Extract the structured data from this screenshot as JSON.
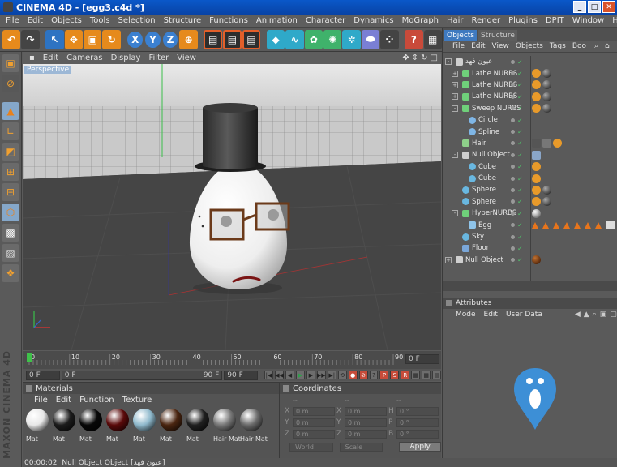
{
  "window": {
    "title": "CINEMA 4D - [egg3.c4d *]"
  },
  "menus": [
    "File",
    "Edit",
    "Objects",
    "Tools",
    "Selection",
    "Structure",
    "Functions",
    "Animation",
    "Character",
    "Dynamics",
    "MoGraph",
    "Hair",
    "Render",
    "Plugins",
    "DPIT",
    "Window",
    "Help"
  ],
  "viewport": {
    "menu": [
      "Edit",
      "Cameras",
      "Display",
      "Filter",
      "View"
    ],
    "label": "Perspective"
  },
  "timeline": {
    "ticks": [
      "0",
      "10",
      "20",
      "30",
      "40",
      "50",
      "60",
      "70",
      "80",
      "90"
    ],
    "current": "0 F",
    "start": "0 F",
    "preview_start": "0 F",
    "preview_end": "90 F",
    "end": "90 F"
  },
  "materials": {
    "title": "Materials",
    "menu": [
      "File",
      "Edit",
      "Function",
      "Texture"
    ],
    "items": [
      {
        "name": "Mat",
        "color": "#e8e8e8"
      },
      {
        "name": "Mat",
        "color": "#1c1c1c"
      },
      {
        "name": "Mat",
        "color": "#080808"
      },
      {
        "name": "Mat",
        "color": "#5a0a0a"
      },
      {
        "name": "Mat",
        "color": "#8fb9cc"
      },
      {
        "name": "Mat",
        "color": "#4a2510"
      },
      {
        "name": "Mat",
        "color": "#202020"
      },
      {
        "name": "Hair Mat",
        "color": "#777777"
      },
      {
        "name": "Hair Mat",
        "color": "#6a6a6a"
      }
    ]
  },
  "coordinates": {
    "title": "Coordinates",
    "header": [
      "--",
      "--",
      "--"
    ],
    "rows": [
      {
        "a": "X",
        "av": "0 m",
        "b": "X",
        "bv": "0 m",
        "c": "H",
        "cv": "0 °"
      },
      {
        "a": "Y",
        "av": "0 m",
        "b": "Y",
        "bv": "0 m",
        "c": "P",
        "cv": "0 °"
      },
      {
        "a": "Z",
        "av": "0 m",
        "b": "Z",
        "bv": "0 m",
        "c": "B",
        "cv": "0 °"
      }
    ],
    "mode_left": "World",
    "mode_right": "Scale",
    "apply": "Apply"
  },
  "status": {
    "time": "00:00:02",
    "message": "Null Object Object [عيون فهد]"
  },
  "objects": {
    "tabs": [
      "Objects",
      "Structure"
    ],
    "menu": [
      "File",
      "Edit",
      "View",
      "Objects",
      "Tags",
      "Boo"
    ],
    "items": [
      {
        "name": "عيون فهد",
        "indent": 0,
        "icon": "null",
        "tree": "-"
      },
      {
        "name": "Lathe NURBS",
        "indent": 1,
        "icon": "nurbs",
        "tree": "+"
      },
      {
        "name": "Lathe NURBS",
        "indent": 1,
        "icon": "nurbs",
        "tree": "+"
      },
      {
        "name": "Lathe NURBS",
        "indent": 1,
        "icon": "nurbs",
        "tree": "+"
      },
      {
        "name": "Sweep NURBS",
        "indent": 1,
        "icon": "nurbs",
        "tree": "-"
      },
      {
        "name": "Circle",
        "indent": 2,
        "icon": "spline",
        "tree": ""
      },
      {
        "name": "Spline",
        "indent": 2,
        "icon": "spline",
        "tree": ""
      },
      {
        "name": "Hair",
        "indent": 1,
        "icon": "hair",
        "tree": ""
      },
      {
        "name": "Null Object",
        "indent": 1,
        "icon": "null",
        "tree": "-"
      },
      {
        "name": "Cube",
        "indent": 2,
        "icon": "prim",
        "tree": ""
      },
      {
        "name": "Cube",
        "indent": 2,
        "icon": "prim",
        "tree": ""
      },
      {
        "name": "Sphere",
        "indent": 1,
        "icon": "prim",
        "tree": ""
      },
      {
        "name": "Sphere",
        "indent": 1,
        "icon": "prim",
        "tree": ""
      },
      {
        "name": "HyperNURBS",
        "indent": 1,
        "icon": "nurbs",
        "tree": "-"
      },
      {
        "name": "Egg",
        "indent": 2,
        "icon": "poly",
        "tree": ""
      },
      {
        "name": "Sky",
        "indent": 1,
        "icon": "prim",
        "tree": ""
      },
      {
        "name": "Floor",
        "indent": 1,
        "icon": "floor",
        "tree": ""
      },
      {
        "name": "Null Object",
        "indent": 0,
        "icon": "null",
        "tree": "+"
      }
    ]
  },
  "attributes": {
    "title": "Attributes",
    "menu": [
      "Mode",
      "Edit",
      "User Data"
    ]
  },
  "colors": {
    "accent": "#e68a1c",
    "selection": "#3f7ac0",
    "brand_pin": "#3d8fd6"
  }
}
